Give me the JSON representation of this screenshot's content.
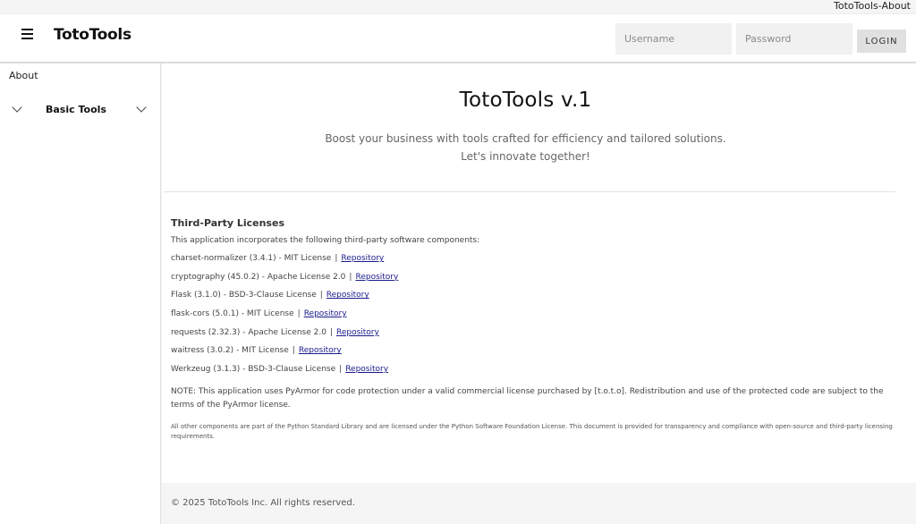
{
  "window": {
    "title": "TotoTools-About"
  },
  "header": {
    "brand": "TotoTools",
    "username_placeholder": "Username",
    "password_placeholder": "Password",
    "login_label": "LOGIN"
  },
  "sidebar": {
    "about_label": "About",
    "group_label": "Basic Tools"
  },
  "hero": {
    "title": "TotoTools v.1",
    "subtitle": "Boost your business with tools crafted for efficiency and tailored solutions. Let's innovate together!"
  },
  "licenses": {
    "title": "Third-Party Licenses",
    "intro": "This application incorporates the following third-party software components:",
    "items": [
      {
        "text": "charset-normalizer (3.4.1) - MIT License",
        "link": "Repository"
      },
      {
        "text": "cryptography (45.0.2) - Apache License 2.0",
        "link": "Repository"
      },
      {
        "text": "Flask (3.1.0) - BSD-3-Clause License",
        "link": "Repository"
      },
      {
        "text": "flask-cors (5.0.1) - MIT License",
        "link": "Repository"
      },
      {
        "text": "requests (2.32.3) - Apache License 2.0",
        "link": "Repository"
      },
      {
        "text": "waitress (3.0.2) - MIT License",
        "link": "Repository"
      },
      {
        "text": "Werkzeug (3.1.3) - BSD-3-Clause License",
        "link": "Repository"
      }
    ],
    "separator": "|",
    "note": "NOTE: This application uses PyArmor for code protection under a valid commercial license purchased by [t.o.t.o]. Redistribution and use of the protected code are subject to the terms of the PyArmor license.",
    "small_print": "All other components are part of the Python Standard Library and are licensed under the Python Software Foundation License. This document is provided for transparency and compliance with open-source and third-party licensing requirements."
  },
  "footer": {
    "text": "© 2025 TotoTools Inc. All rights reserved."
  },
  "icons": {
    "menu": "hamburger-menu-icon",
    "expand": "chevron-down-icon"
  }
}
